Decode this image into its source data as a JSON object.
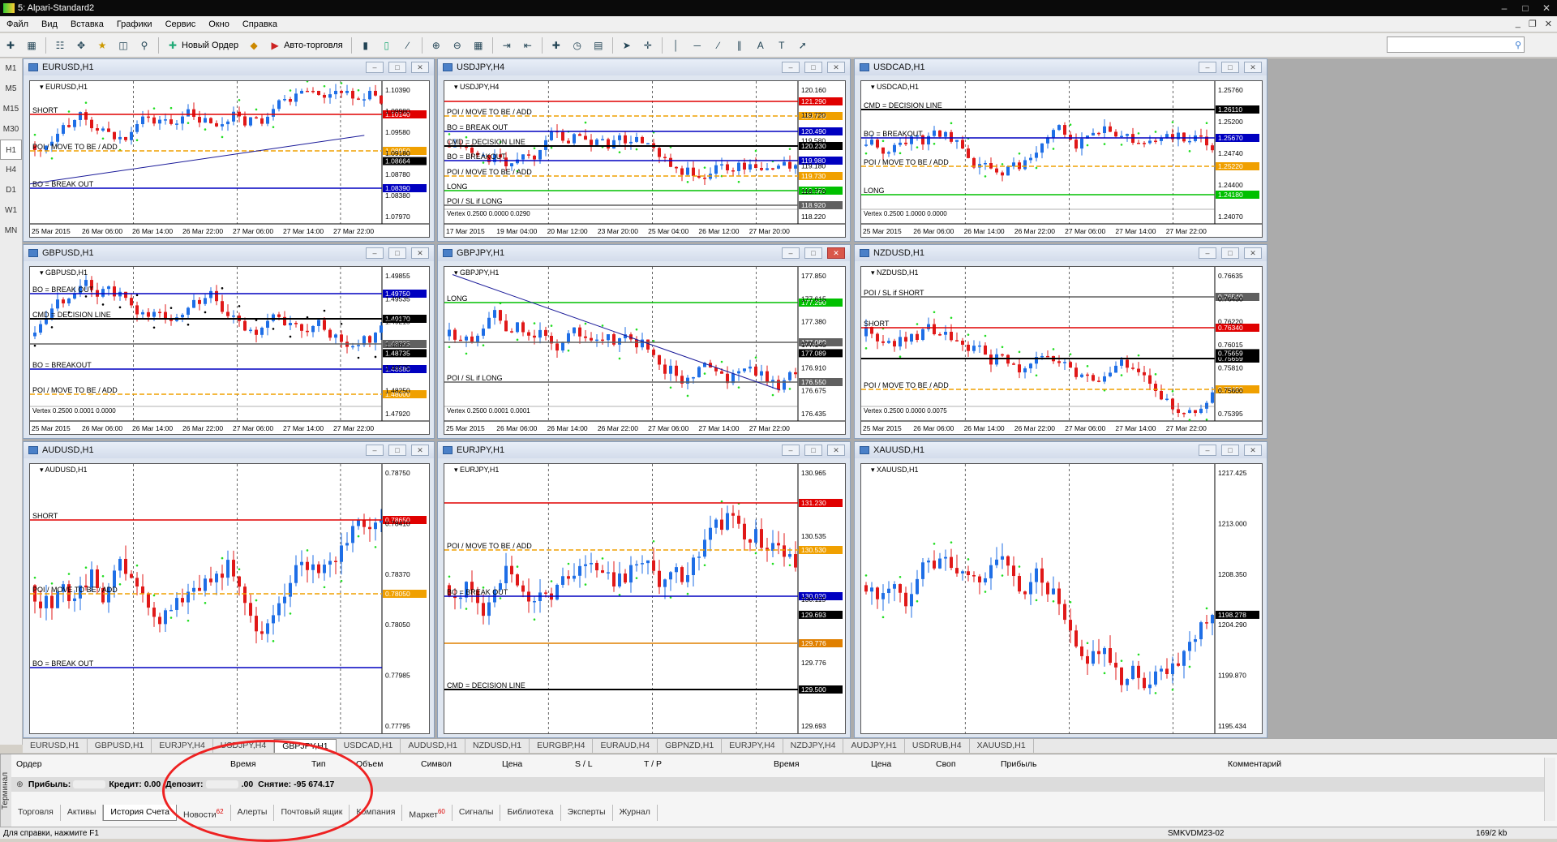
{
  "window": {
    "title": "5: Alpari-Standard2"
  },
  "menu": [
    "Файл",
    "Вид",
    "Вставка",
    "Графики",
    "Сервис",
    "Окно",
    "Справка"
  ],
  "toolbar": {
    "new_order": "Новый Ордер",
    "auto_trading": "Авто-торговля"
  },
  "timeframes": [
    "M1",
    "M5",
    "M15",
    "M30",
    "H1",
    "H4",
    "D1",
    "W1",
    "MN"
  ],
  "active_timeframe": "H1",
  "charts": [
    {
      "title": "EURUSD,H1",
      "symbol": "EURUSD,H1",
      "prices": [
        "1.10390",
        "1.09980",
        "1.09580",
        "1.09180",
        "1.08780",
        "1.08380",
        "1.07970"
      ],
      "levels": [
        {
          "label": "SHORT",
          "price": "1.10140",
          "color": "#e00000"
        },
        {
          "label": "POI / MOVE TO BE / ADD",
          "price": "1.08950",
          "color": "#f0a000"
        },
        {
          "label": "BO = BREAK OUT",
          "price": "1.08390",
          "color": "#0000c0"
        }
      ],
      "current": "1.08664",
      "times": [
        "25 Mar 2015",
        "26 Mar 06:00",
        "26 Mar 14:00",
        "26 Mar 22:00",
        "27 Mar 06:00",
        "27 Mar 14:00",
        "27 Mar 22:00"
      ]
    },
    {
      "title": "USDJPY,H4",
      "symbol": "USDJPY,H4",
      "prices": [
        "120.160",
        "119.720",
        "119.580",
        "119.180",
        "118.770",
        "118.220"
      ],
      "levels": [
        {
          "label": "",
          "price": "121.290",
          "color": "#e00000"
        },
        {
          "label": "POI / MOVE TO BE / ADD",
          "price": "120.740",
          "color": "#f0a000"
        },
        {
          "label": "BO = BREAK OUT",
          "price": "120.490",
          "color": "#0000c0"
        },
        {
          "label": "CMD = DECISION LINE",
          "price": "120.230",
          "color": "#000000"
        },
        {
          "label": "BO = BREAKOUT",
          "price": "119.980",
          "color": "#0000c0"
        },
        {
          "label": "POI / MOVE TO BE / ADD",
          "price": "119.730",
          "color": "#f0a000"
        },
        {
          "label": "LONG",
          "price": "119.180",
          "color": "#00c000"
        },
        {
          "label": "POI / SL if LONG",
          "price": "118.920",
          "color": "#606060"
        }
      ],
      "current": "",
      "indicator": "Vertex 0.2500 0.0000 0.0290",
      "times": [
        "17 Mar 2015",
        "19 Mar 04:00",
        "20 Mar 12:00",
        "23 Mar 20:00",
        "25 Mar 04:00",
        "26 Mar 12:00",
        "27 Mar 20:00"
      ]
    },
    {
      "title": "USDCAD,H1",
      "symbol": "USDCAD,H1",
      "prices": [
        "1.25760",
        "1.25200",
        "1.24740",
        "1.24400",
        "1.24070"
      ],
      "levels": [
        {
          "label": "CMD = DECISION LINE",
          "price": "1.26110",
          "color": "#000000"
        },
        {
          "label": "BO = BREAKOUT",
          "price": "1.25670",
          "color": "#0000c0"
        },
        {
          "label": "POI / MOVE TO BE / ADD",
          "price": "1.25220",
          "color": "#f0a000"
        },
        {
          "label": "LONG",
          "price": "1.24180",
          "color": "#00c000"
        }
      ],
      "current": "",
      "indicator": "Vertex 0.2500 1.0000 0.0000",
      "times": [
        "25 Mar 2015",
        "26 Mar 06:00",
        "26 Mar 14:00",
        "26 Mar 22:00",
        "27 Mar 06:00",
        "27 Mar 14:00",
        "27 Mar 22:00"
      ]
    },
    {
      "title": "GBPUSD,H1",
      "symbol": "GBPUSD,H1",
      "prices": [
        "1.49855",
        "1.49535",
        "1.49215",
        "1.48895",
        "1.48575",
        "1.48250",
        "1.47920"
      ],
      "levels": [
        {
          "label": "BO = BREAK OUT",
          "price": "1.49750",
          "color": "#0000c0"
        },
        {
          "label": "CMD = DECISION LINE",
          "price": "1.49170",
          "color": "#000000"
        },
        {
          "label": "",
          "price": "1.48735",
          "color": "#606060"
        },
        {
          "label": "BO = BREAKOUT",
          "price": "1.48580",
          "color": "#0000c0"
        },
        {
          "label": "POI / MOVE TO BE / ADD",
          "price": "1.48000",
          "color": "#f0a000"
        }
      ],
      "current": "1.48735",
      "indicator": "Vertex 0.2500 0.0001 0.0000",
      "times": [
        "25 Mar 2015",
        "26 Mar 06:00",
        "26 Mar 14:00",
        "26 Mar 22:00",
        "27 Mar 06:00",
        "27 Mar 14:00",
        "27 Mar 22:00"
      ]
    },
    {
      "title": "GBPJPY,H1",
      "symbol": "GBPJPY,H1",
      "prices": [
        "177.850",
        "177.615",
        "177.380",
        "177.145",
        "176.910",
        "176.675",
        "176.435"
      ],
      "levels": [
        {
          "label": "LONG",
          "price": "177.290",
          "color": "#00c000"
        },
        {
          "label": "",
          "price": "177.089",
          "color": "#606060"
        },
        {
          "label": "POI / SL if LONG",
          "price": "176.550",
          "color": "#606060"
        }
      ],
      "current": "177.089",
      "indicator": "Vertex 0.2500 0.0001 0.0001",
      "times": [
        "25 Mar 2015",
        "26 Mar 06:00",
        "26 Mar 14:00",
        "26 Mar 22:00",
        "27 Mar 06:00",
        "27 Mar 14:00",
        "27 Mar 22:00"
      ]
    },
    {
      "title": "NZDUSD,H1",
      "symbol": "NZDUSD,H1",
      "prices": [
        "0.76635",
        "0.76430",
        "0.76220",
        "0.76015",
        "0.75810",
        "0.75600",
        "0.75395"
      ],
      "levels": [
        {
          "label": "POI / SL if SHORT",
          "price": "0.76540",
          "color": "#606060"
        },
        {
          "label": "SHORT",
          "price": "0.76340",
          "color": "#e00000"
        },
        {
          "label": "",
          "price": "0.75659",
          "color": "#000000"
        },
        {
          "label": "POI / MOVE TO BE / ADD",
          "price": "0.75450",
          "color": "#f0a000"
        }
      ],
      "current": "0.75659",
      "indicator": "Vertex 0.2500 0.0000 0.0075",
      "times": [
        "25 Mar 2015",
        "26 Mar 06:00",
        "26 Mar 14:00",
        "26 Mar 22:00",
        "27 Mar 06:00",
        "27 Mar 14:00",
        "27 Mar 22:00"
      ]
    },
    {
      "title": "AUDUSD,H1",
      "symbol": "AUDUSD,H1",
      "prices": [
        "0.78750",
        "0.78410",
        "0.78370",
        "0.78050",
        "0.77985",
        "0.77795"
      ],
      "levels": [
        {
          "label": "SHORT",
          "price": "0.78650",
          "color": "#e00000"
        },
        {
          "label": "POI / MOVE TO BE / ADD",
          "price": "0.78050",
          "color": "#f0a000"
        },
        {
          "label": "BO = BREAK OUT",
          "price": "",
          "color": "#0000c0"
        }
      ],
      "current": "",
      "times": []
    },
    {
      "title": "EURJPY,H1",
      "symbol": "EURJPY,H1",
      "prices": [
        "130.965",
        "130.535",
        "130.115",
        "129.776",
        "129.693"
      ],
      "levels": [
        {
          "label": "",
          "price": "131.230",
          "color": "#e00000"
        },
        {
          "label": "POI / MOVE TO BE / ADD",
          "price": "130.530",
          "color": "#f0a000"
        },
        {
          "label": "BO = BREAK OUT",
          "price": "130.020",
          "color": "#0000c0"
        },
        {
          "label": "",
          "price": "129.776",
          "color": "#e08000"
        },
        {
          "label": "CMD = DECISION LINE",
          "price": "129.500",
          "color": "#000000"
        }
      ],
      "current": "129.693",
      "times": []
    },
    {
      "title": "XAUUSD,H1",
      "symbol": "XAUUSD,H1",
      "prices": [
        "1217.425",
        "1213.000",
        "1208.350",
        "1204.290",
        "1199.870",
        "1195.434"
      ],
      "levels": [],
      "current": "1198.278",
      "times": []
    }
  ],
  "chart_tabs": [
    "EURUSD,H1",
    "GBPUSD,H1",
    "EURJPY,H4",
    "USDJPY,H4",
    "GBPJPY,H1",
    "USDCAD,H1",
    "AUDUSD,H1",
    "NZDUSD,H1",
    "EURGBP,H4",
    "EURAUD,H4",
    "GBPNZD,H1",
    "EURJPY,H4",
    "NZDJPY,H4",
    "AUDJPY,H1",
    "USDRUB,H4",
    "XAUUSD,H1"
  ],
  "active_chart_tab": 4,
  "terminal": {
    "side_label": "Терминал",
    "columns": [
      "Ордер",
      "Время",
      "Тип",
      "Объем",
      "Символ",
      "Цена",
      "S / L",
      "T / P",
      "Время",
      "Цена",
      "Своп",
      "Прибыль",
      "Комментарий"
    ],
    "summary": {
      "profit_label": "Прибыль:",
      "credit_label": "Кредит:",
      "credit_value": "0.00",
      "deposit_label": "Депозит:",
      "deposit_value": ".00",
      "withdrawal_label": "Снятие:",
      "withdrawal_value": "-95 674.17"
    },
    "tabs": [
      {
        "label": "Торговля",
        "badge": ""
      },
      {
        "label": "Активы",
        "badge": ""
      },
      {
        "label": "История Счета",
        "badge": ""
      },
      {
        "label": "Новости",
        "badge": "62"
      },
      {
        "label": "Алерты",
        "badge": ""
      },
      {
        "label": "Почтовый ящик",
        "badge": ""
      },
      {
        "label": "Компания",
        "badge": ""
      },
      {
        "label": "Маркет",
        "badge": "60"
      },
      {
        "label": "Сигналы",
        "badge": ""
      },
      {
        "label": "Библиотека",
        "badge": ""
      },
      {
        "label": "Эксперты",
        "badge": ""
      },
      {
        "label": "Журнал",
        "badge": ""
      }
    ],
    "active_tab": 2
  },
  "status": {
    "help": "Для справки, нажмите F1",
    "profile": "SMKVDM23-02",
    "traffic": "169/2 kb"
  }
}
